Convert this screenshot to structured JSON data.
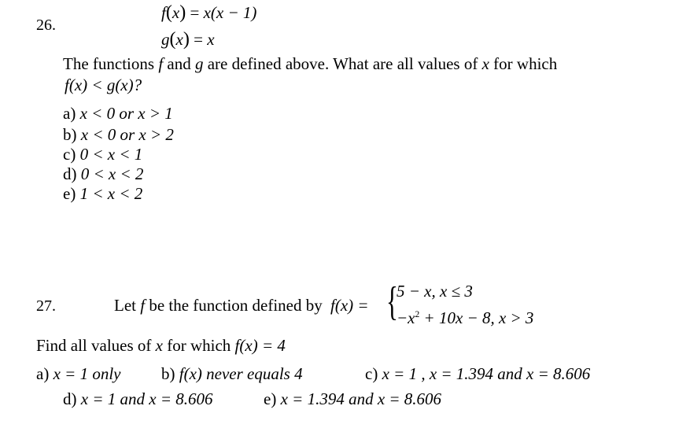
{
  "q26": {
    "number": "26.",
    "def_f": "f(x) = x(x − 1)",
    "def_f_parts": {
      "lhs_fn": "f",
      "var": "x",
      "eq": "=",
      "rhs": "x(x − 1)"
    },
    "def_g_parts": {
      "lhs_fn": "g",
      "var": "x",
      "eq": "=",
      "rhs": "x"
    },
    "prompt_start": "The functions ",
    "prompt_f": "f",
    "prompt_mid": " and ",
    "prompt_g": "g",
    "prompt_end": " are defined above.  What are all values of ",
    "prompt_x": "x",
    "prompt_tail": " for which",
    "inequality": "f(x) < g(x)?",
    "choices": [
      {
        "label": "a)",
        "text": "x < 0  or  x > 1"
      },
      {
        "label": "b)",
        "text": "x < 0  or  x > 2"
      },
      {
        "label": "c)",
        "text": "0 < x < 1"
      },
      {
        "label": "d)",
        "text": "0 < x < 2"
      },
      {
        "label": "e)",
        "text": "1 < x < 2"
      }
    ]
  },
  "q27": {
    "number": "27.",
    "prompt_start": "Let ",
    "prompt_f": "f",
    "prompt_end": " be the function defined by",
    "fn_lhs": "f(x) =",
    "piece1": "5 − x,  x ≤ 3",
    "piece2_a": "−x",
    "piece2_exp": "2",
    "piece2_b": " + 10x − 8,  x > 3",
    "find_start": "Find all values of ",
    "find_x": "x",
    "find_mid": " for which ",
    "find_eq": "f(x) = 4",
    "choices": [
      {
        "label": "a)",
        "text": "x = 1 only"
      },
      {
        "label": "b)",
        "text": "f(x) never equals 4"
      },
      {
        "label": "c)",
        "text": "x = 1 ,  x = 1.394  and  x = 8.606"
      },
      {
        "label": "d)",
        "text": "x = 1 and  x = 8.606"
      },
      {
        "label": "e)",
        "text": "x = 1.394  and  x = 8.606"
      }
    ]
  }
}
